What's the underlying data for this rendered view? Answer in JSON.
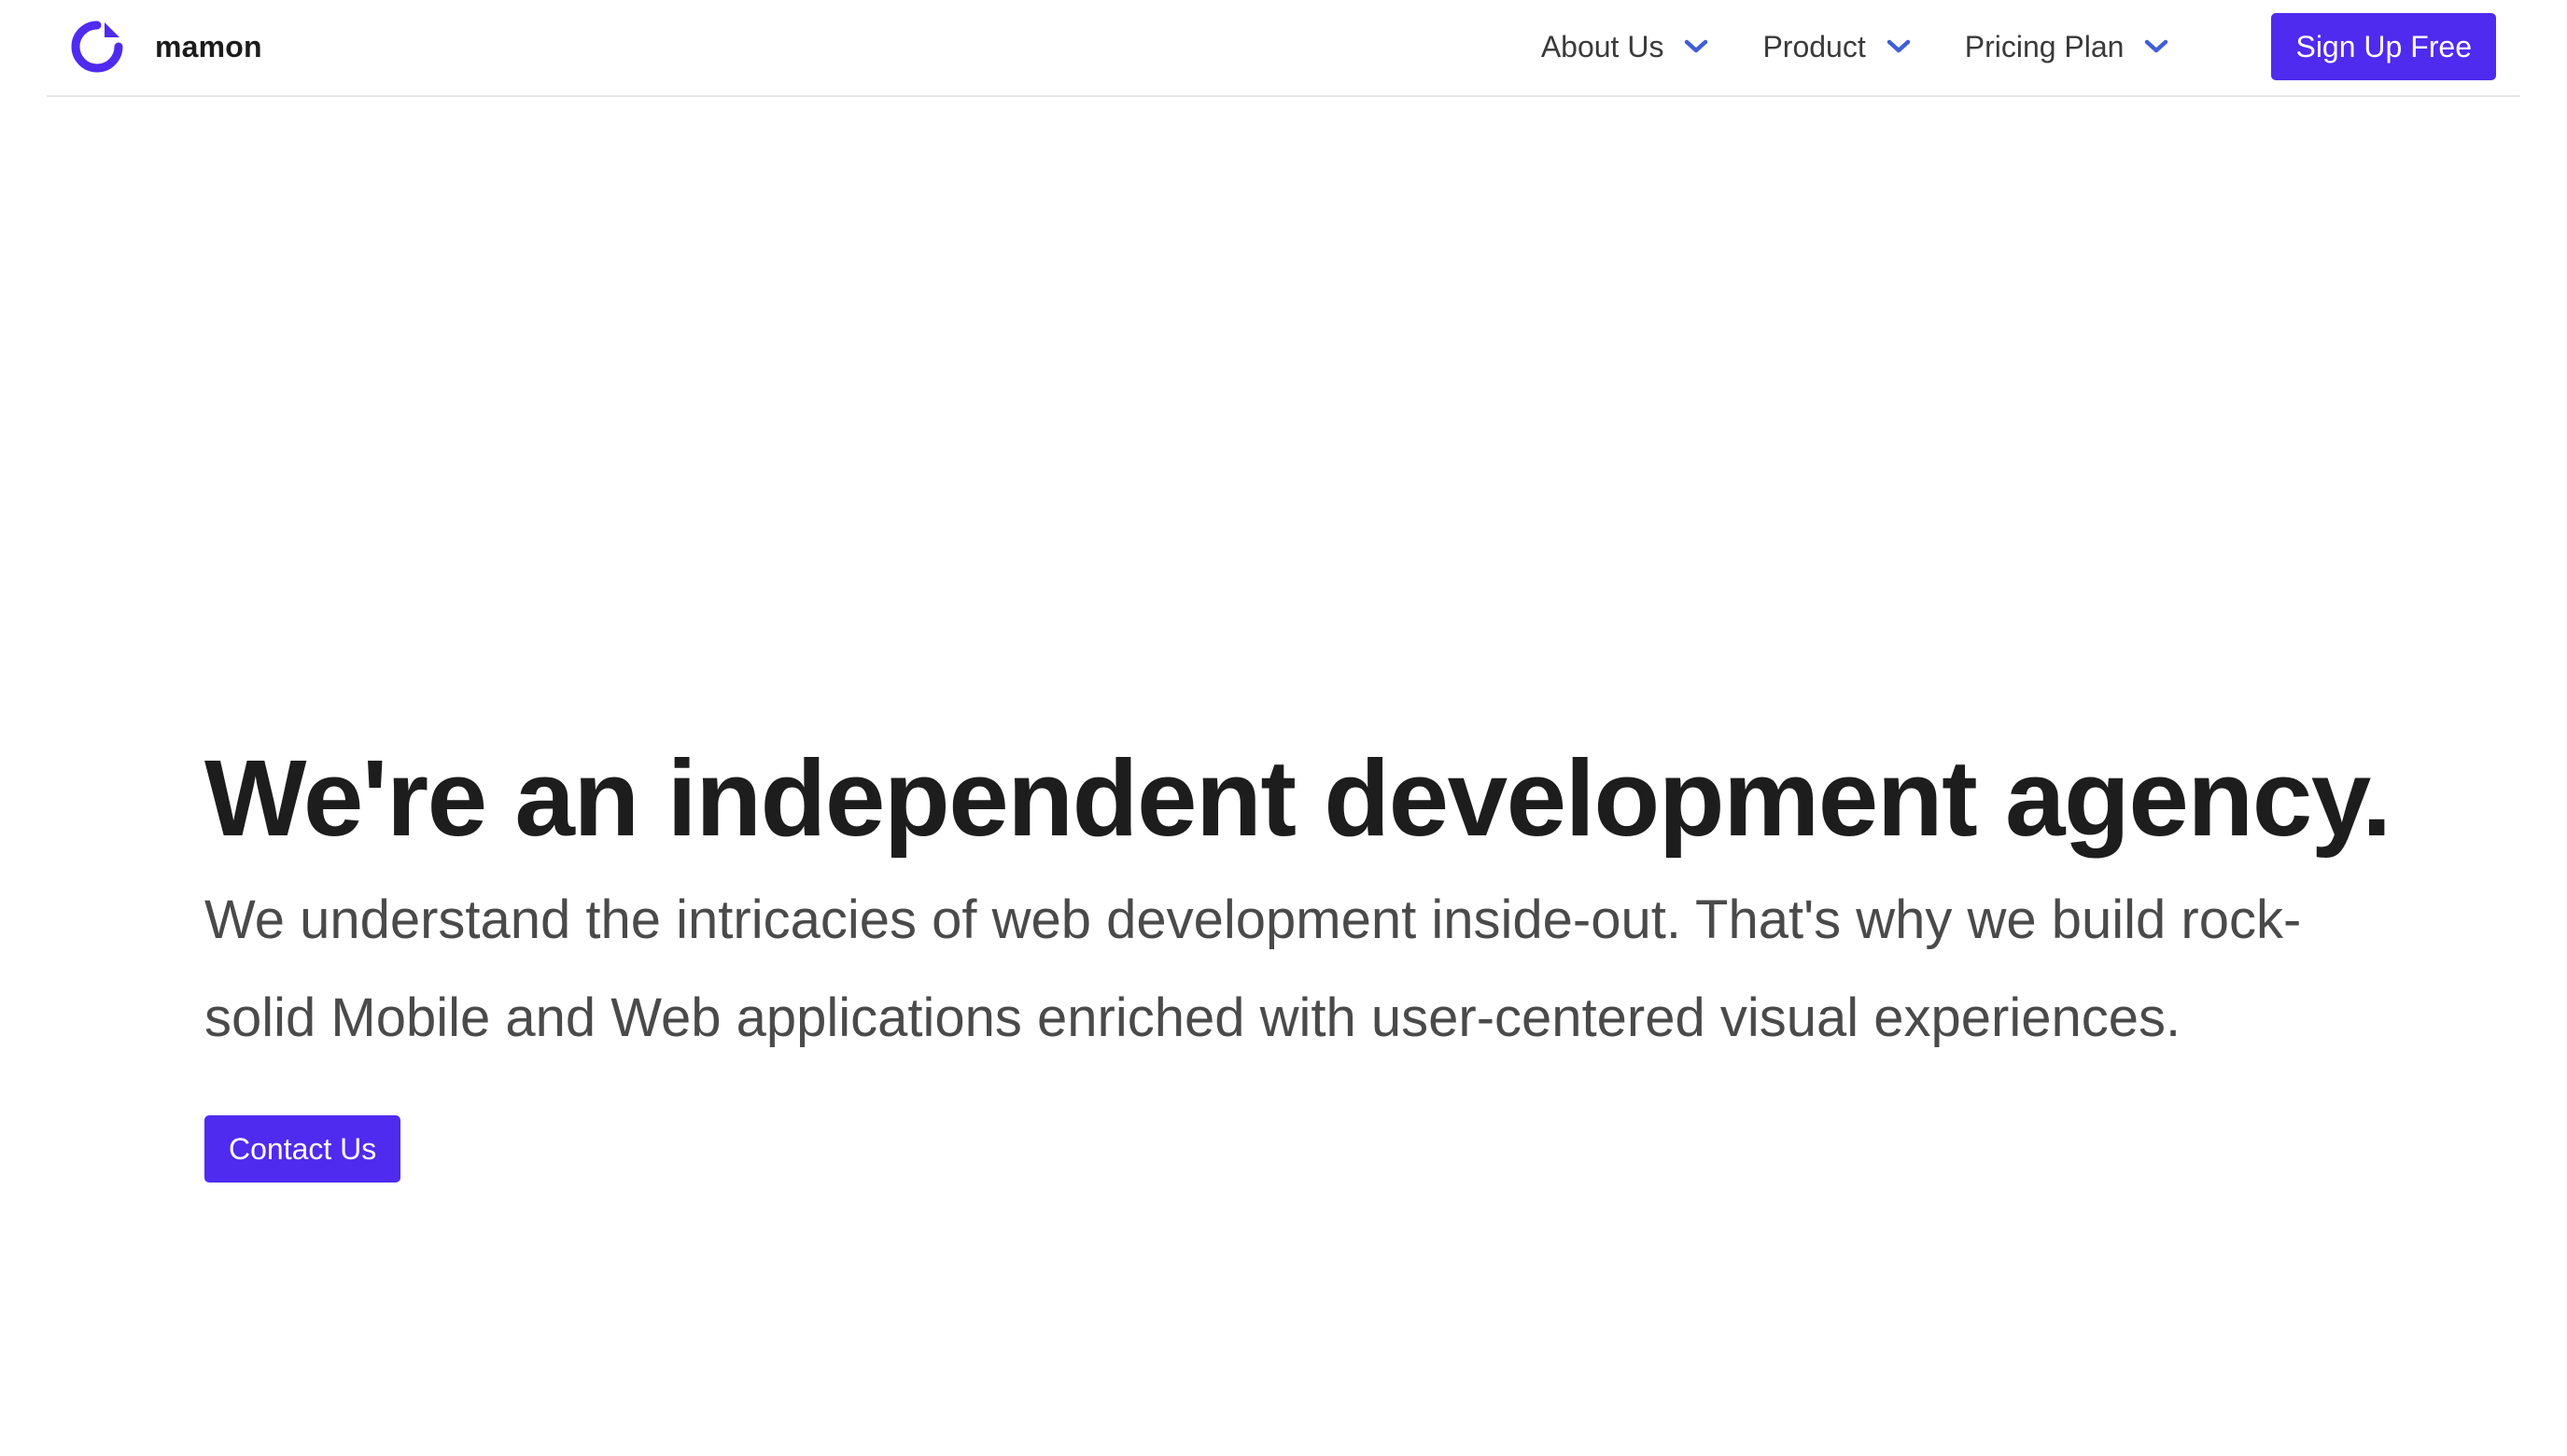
{
  "brand": {
    "name": "mamon",
    "logo_icon": "circular-arrow-logo-icon",
    "logo_color": "#4f2bef"
  },
  "nav": {
    "items": [
      {
        "label": "About Us",
        "icon": "chevron-down-icon"
      },
      {
        "label": "Product",
        "icon": "chevron-down-icon"
      },
      {
        "label": "Pricing Plan",
        "icon": "chevron-down-icon"
      }
    ],
    "signup_label": "Sign Up Free",
    "chevron_color": "#3f5fd6"
  },
  "hero": {
    "title": "We're an independent development agency.",
    "subtitle": "We understand the intricacies of web development inside-out. That's why we build rock-solid Mobile and Web applications enriched with user-centered visual experiences.",
    "cta_label": "Contact Us"
  },
  "colors": {
    "accent": "#4f2bef",
    "text_primary": "#1d1d1d",
    "text_secondary": "#4a4a4a",
    "divider": "#e6e6e9"
  }
}
